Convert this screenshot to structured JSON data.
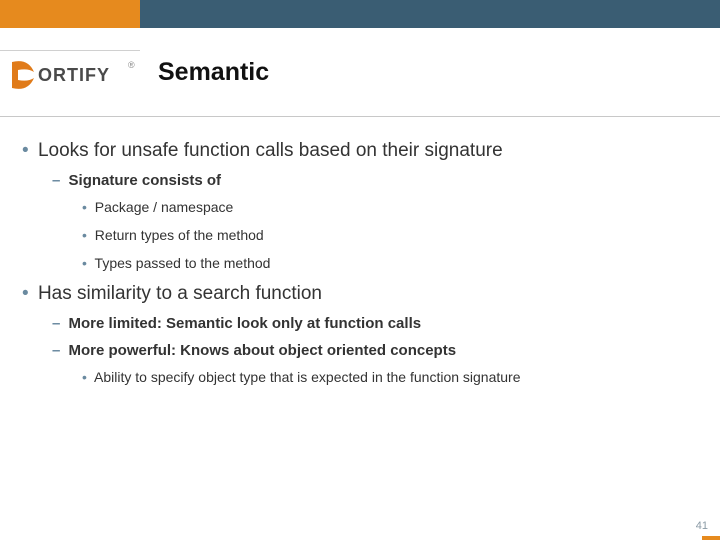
{
  "brand": {
    "name": "FORTIFY",
    "registered": "®"
  },
  "title": "Semantic",
  "bullets": [
    {
      "text": "Looks for unsafe function calls based on their signature",
      "sub": [
        {
          "text": "Signature consists of",
          "sub": [
            {
              "text": "Package / namespace"
            },
            {
              "text": "Return types of the method"
            },
            {
              "text": "Types passed to the method"
            }
          ]
        }
      ]
    },
    {
      "text": "Has similarity to a search function",
      "sub": [
        {
          "text": "More limited: Semantic look only at function calls"
        },
        {
          "text": "More powerful: Knows about object oriented concepts",
          "sub": [
            {
              "text": "Ability to specify object type that is expected in the function signature"
            }
          ]
        }
      ]
    }
  ],
  "page_number": "41"
}
